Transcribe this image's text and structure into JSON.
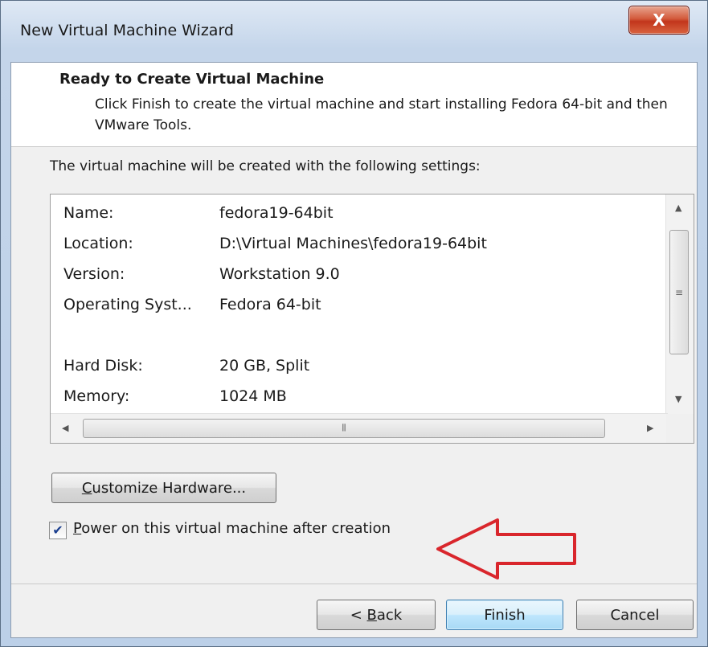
{
  "window": {
    "title": "New Virtual Machine Wizard",
    "close_glyph": "X"
  },
  "header": {
    "title": "Ready to Create Virtual Machine",
    "description": "Click Finish to create the virtual machine and start installing Fedora 64-bit and then VMware Tools."
  },
  "intro": "The virtual machine will be created with the following settings:",
  "settings": [
    {
      "label": "Name:",
      "value": "fedora19-64bit"
    },
    {
      "label": "Location:",
      "value": "D:\\Virtual Machines\\fedora19-64bit"
    },
    {
      "label": "Version:",
      "value": "Workstation 9.0"
    },
    {
      "label": "Operating Syst...",
      "value": "Fedora 64-bit"
    },
    {
      "label": "Hard Disk:",
      "value": "20 GB, Split"
    },
    {
      "label": "Memory:",
      "value": "1024 MB"
    }
  ],
  "customize": {
    "accel": "C",
    "rest": "ustomize Hardware..."
  },
  "power": {
    "checked": true,
    "accel": "P",
    "rest": "ower on this virtual machine after creation"
  },
  "buttons": {
    "back_prefix": "< ",
    "back_accel": "B",
    "back_rest": "ack",
    "finish": "Finish",
    "cancel": "Cancel"
  },
  "colors": {
    "annotation_arrow": "#d9262c",
    "default_button_border": "#3c7fb1"
  },
  "icons": {
    "close": "close-icon",
    "checkmark": "checkmark-icon",
    "grip": "scroll-grip-icon"
  }
}
